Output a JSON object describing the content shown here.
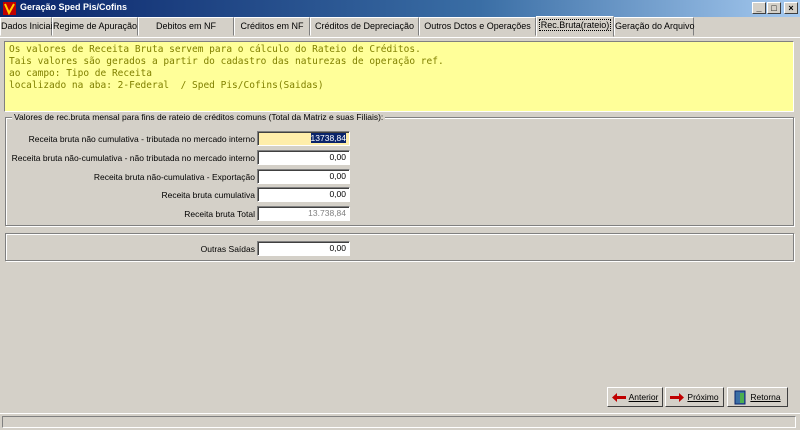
{
  "window": {
    "title": "Geração Sped Pis/Cofins",
    "controls": [
      "_",
      "□",
      "×"
    ]
  },
  "tabs": [
    {
      "label": "Dados Iniciais"
    },
    {
      "label": "Regime de Apuração"
    },
    {
      "label": "Debitos em NF"
    },
    {
      "label": "Créditos em NF"
    },
    {
      "label": "Créditos de Depreciação"
    },
    {
      "label": "Outros Dctos e Operações"
    },
    {
      "label": "Rec.Bruta(rateio)"
    },
    {
      "label": "Geração do Arquivo"
    }
  ],
  "info_lines": [
    "Os valores de Receita Bruta servem para o cálculo do Rateio de Créditos.",
    "Tais valores são gerados a partir do cadastro das naturezas de operação ref.",
    "ao campo: Tipo de Receita",
    "localizado na aba: 2-Federal  / Sped Pis/Cofins(Saidas)"
  ],
  "group_receita": {
    "title": "Valores de rec.bruta mensal para fins de rateio de créditos comuns (Total da Matriz e suas Filiais):",
    "rows": [
      {
        "label": "Receita bruta não cumulativa - tributada no mercado interno",
        "value": "13738,84"
      },
      {
        "label": "Receita bruta não-cumulativa - não tributada no mercado interno",
        "value": "0,00"
      },
      {
        "label": "Receita bruta não-cumulativa -  Exportação",
        "value": "0,00"
      },
      {
        "label": "Receita bruta cumulativa",
        "value": "0,00"
      },
      {
        "label": "Receita bruta Total",
        "value": "13.738,84"
      }
    ]
  },
  "group_outras": {
    "label": "Outras Saídas",
    "value": "0,00"
  },
  "buttons": {
    "anterior": "Anterior",
    "proximo": "Próximo",
    "retorna": "Retorna"
  }
}
